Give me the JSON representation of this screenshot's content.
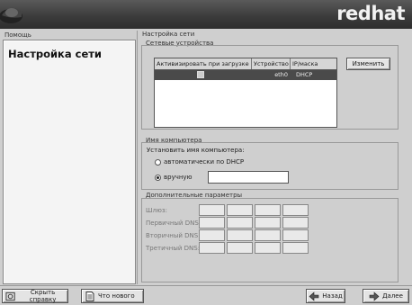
{
  "banner": {
    "logo": "redhat"
  },
  "help": {
    "label": "Помощь",
    "heading": "Настройка сети"
  },
  "main": {
    "section_title": "Настройка сети",
    "devices": {
      "label": "Сетевые устройства",
      "columns": [
        "Активизировать при загрузке",
        "Устройство",
        "IP/маска"
      ],
      "rows": [
        {
          "activate": true,
          "device": "eth0",
          "ip": "DHCP"
        }
      ],
      "edit_button": "Изменить"
    },
    "hostname": {
      "label": "Имя компьютера",
      "set_label": "Установить имя компьютера:",
      "options": [
        {
          "label": "автоматически по DHCP",
          "selected": false
        },
        {
          "label": "вручную",
          "selected": true
        }
      ],
      "value": ""
    },
    "extra": {
      "label": "Дополнительные параметры",
      "fields": [
        "Шлюз:",
        "Первичный DNS:",
        "Вторичный DNS:",
        "Третичный DNS:"
      ]
    }
  },
  "footer": {
    "hide_help": "Скрыть справку",
    "whats_new": "Что нового",
    "back": "Назад",
    "next": "Далее"
  }
}
